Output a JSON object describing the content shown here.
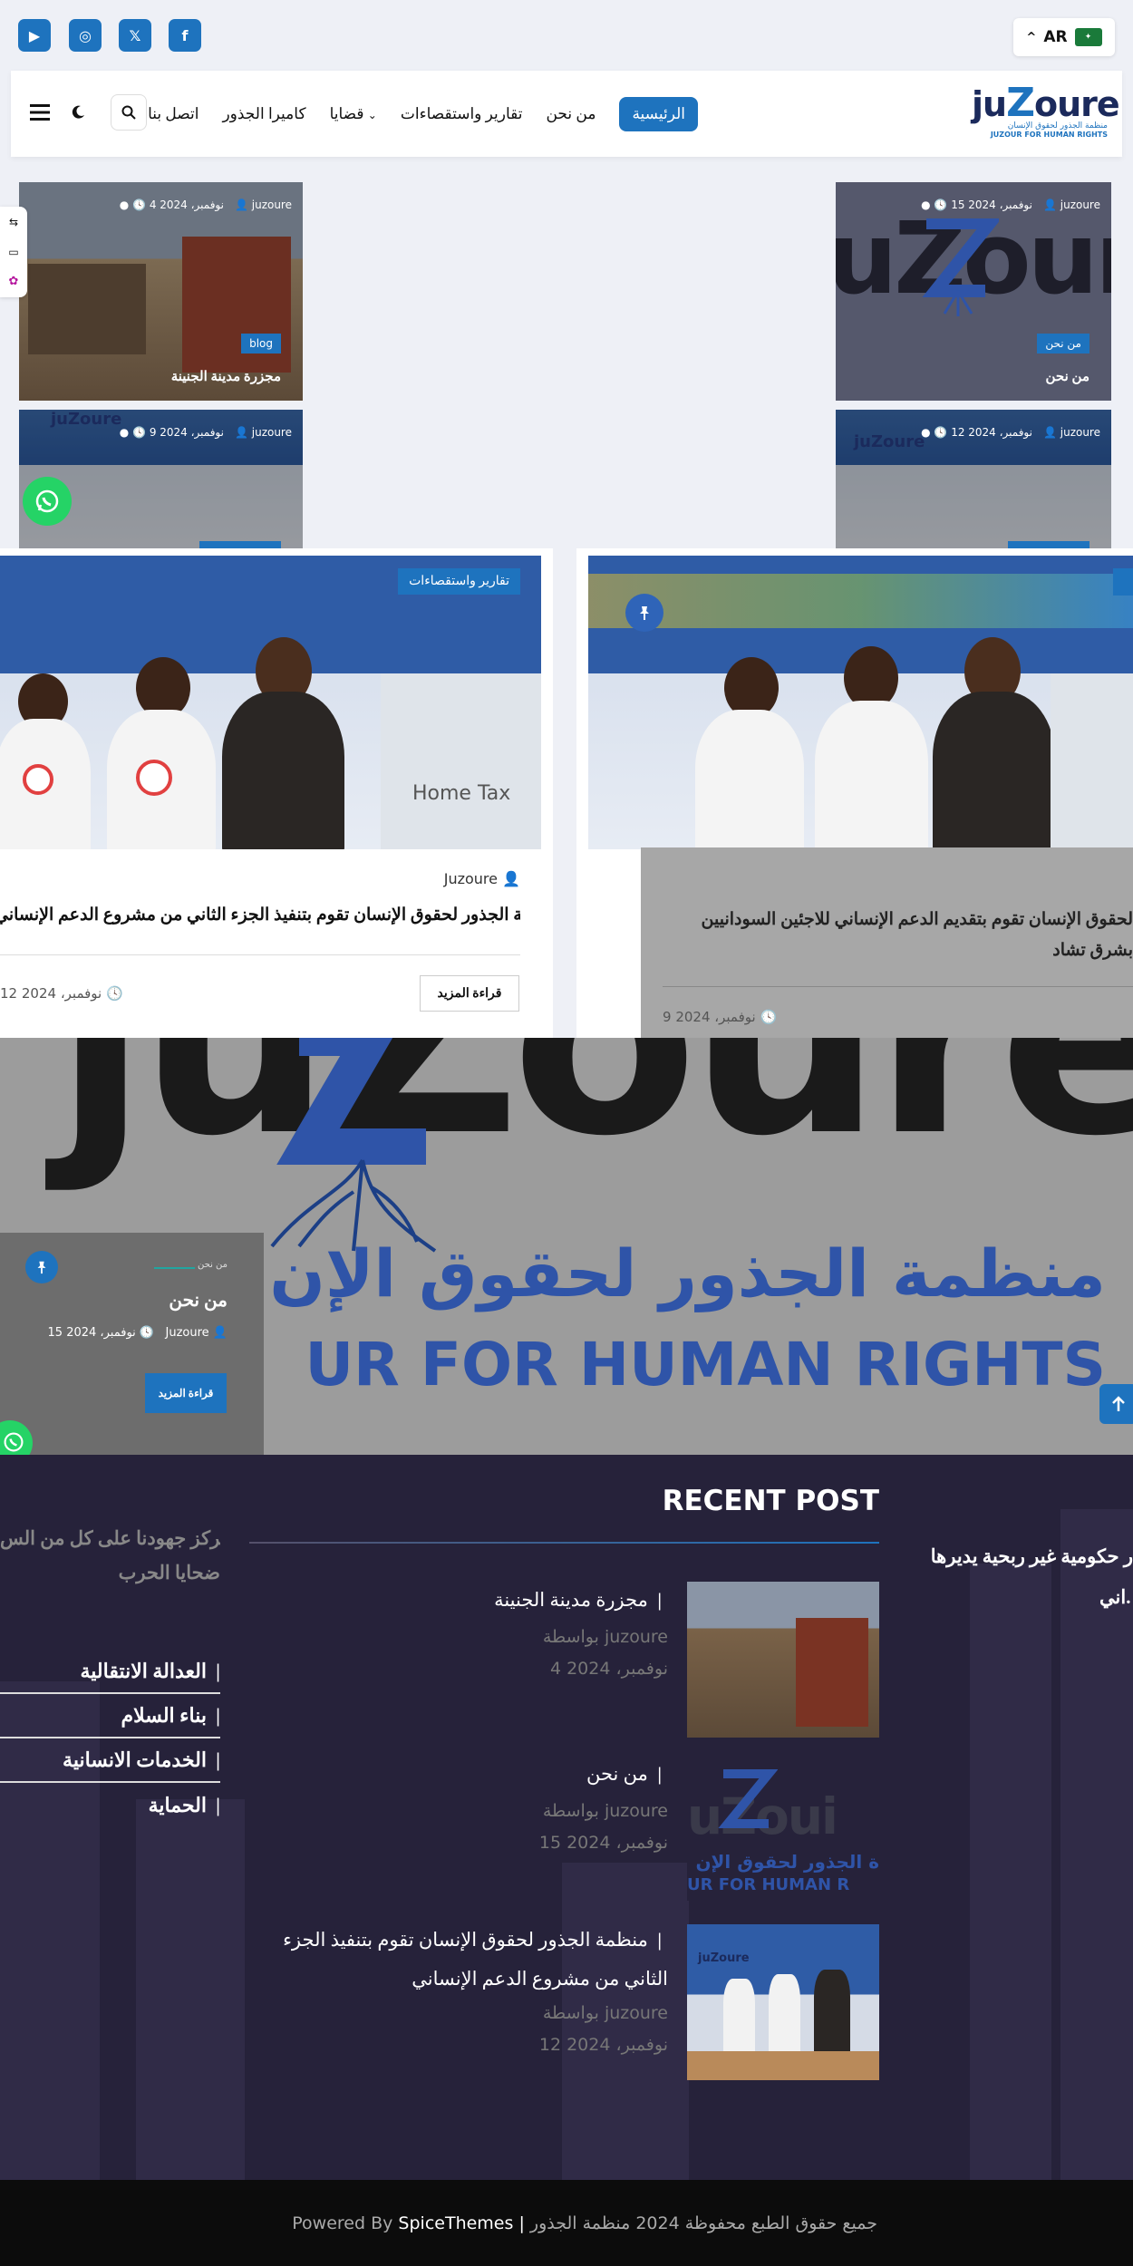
{
  "topbar": {
    "social": [
      {
        "icon": "youtube-icon",
        "glyph": "▶"
      },
      {
        "icon": "instagram-icon",
        "glyph": "◎"
      },
      {
        "icon": "x-twitter-icon",
        "glyph": "𝕏"
      },
      {
        "icon": "facebook-icon",
        "glyph": "f"
      }
    ],
    "language": "AR",
    "language_caret": "^"
  },
  "logo": {
    "text_a": "ju",
    "text_z": "Z",
    "text_b": "oure",
    "subtitle_ar": "منظمة الجذور لحقوق الإنسان",
    "subtitle_en": "JUZOUR FOR HUMAN RIGHTS"
  },
  "menu": {
    "home": "الرئيسية",
    "about": "من نحن",
    "reports": "تقارير واستقصاءات",
    "issues": "قضايا",
    "issues_caret": "⌄",
    "cameras": "كاميرا الجذور",
    "contact": "اتصل بنا"
  },
  "grid_cards": [
    {
      "author": "juzoure",
      "date": "15 نوفمبر، 2024",
      "badge": "من نحن",
      "title": "من نحن"
    },
    {
      "author": "juzoure",
      "date": "4 نوفمبر، 2024",
      "badge": "blog",
      "title": "مجزرة مدينة الجنينة"
    },
    {
      "author": "juzoure",
      "date": "12 نوفمبر، 2024"
    },
    {
      "author": "juzoure",
      "date": "9 نوفمبر، 2024"
    }
  ],
  "posts": {
    "left": {
      "category": "تقارير واستقصاءات",
      "author": "Juzoure",
      "title": "منظمة الجذور  لحقوق الإنسان تقوم بتنفيذ الجزء الثاني من  مشروع الدعم الإنساني",
      "read_more": "قراءة المزيد",
      "date": "12 نوفمبر، 2024"
    },
    "right": {
      "title_line1": "لحقوق الإنسان تقوم بتقديم الدعم الإنساني للاجئين السودانيين",
      "title_line2": "بشرق تشاد",
      "date": "9 نوفمبر، 2024"
    }
  },
  "hero": {
    "logo_text": "juZoure",
    "arabic": "منظمة الجذور لحقوق الإن",
    "english": "UR FOR HUMAN RIGHTS",
    "card": {
      "category": "من نحن",
      "title": "من نحن",
      "date": "15 نوفمبر، 2024",
      "author": "Juzoure",
      "read_more": "قراءة المزيد"
    }
  },
  "footer": {
    "about_cut": "ر حكومية غير ربحية يديرها",
    "about_cut2": "اني.",
    "recent_title": "RECENT POST",
    "recent": [
      {
        "title": "مجزرة مدينة الجنينة",
        "by": "بواسطة juzoure",
        "date": "4 نوفمبر، 2024"
      },
      {
        "title": "من نحن",
        "by": "بواسطة juzoure",
        "date": "15 نوفمبر، 2024"
      },
      {
        "title": "منظمة الجذور  لحقوق الإنسان تقوم بتنفيذ الجزء",
        "title2": "الثاني من  مشروع الدعم الإنساني",
        "by": "بواسطة juzoure",
        "date": "12 نوفمبر، 2024"
      }
    ],
    "focus_text1": "تتركز جهودنا على كل من الس",
    "focus_text2": "ضحايا الحرب",
    "links": [
      "العدالة الانتقالية",
      "بناء السلام",
      "الخدمات الانسانية",
      "الحماية"
    ],
    "thumb2_text": "ة الجذور لحقوق الإن",
    "thumb2_en": "UR FOR HUMAN R"
  },
  "copyright": {
    "powered": "Powered By",
    "brand": "SpiceThemes",
    "sep": "|",
    "rights": "جميع حقوق الطبع محفوظة 2024 منظمة الجذور"
  },
  "colors": {
    "accent": "#1e73be",
    "whatsapp": "#25d366",
    "footer_bg": "#26223a"
  }
}
